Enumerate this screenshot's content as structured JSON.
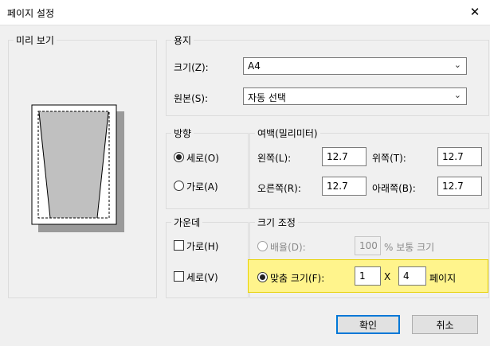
{
  "window": {
    "title": "페이지 설정",
    "close_glyph": "✕"
  },
  "preview": {
    "legend": "미리 보기"
  },
  "paper": {
    "legend": "용지",
    "size_label": "크기(Z):",
    "size_value": "A4",
    "source_label": "원본(S):",
    "source_value": "자동 선택"
  },
  "orientation": {
    "legend": "방향",
    "portrait_label": "세로(O)",
    "landscape_label": "가로(A)",
    "selected": "portrait"
  },
  "margins": {
    "legend": "여백(밀리미터)",
    "left_label": "왼쪽(L):",
    "left_value": "12.7",
    "top_label": "위쪽(T):",
    "top_value": "12.7",
    "right_label": "오른쪽(R):",
    "right_value": "12.7",
    "bottom_label": "아래쪽(B):",
    "bottom_value": "12.7"
  },
  "center": {
    "legend": "가운데",
    "horizontal_label": "가로(H)",
    "vertical_label": "세로(V)"
  },
  "scaling": {
    "legend": "크기 조정",
    "adjust_label": "배율(D):",
    "adjust_value": "100",
    "adjust_suffix": "% 보통 크기",
    "fit_label": "맞춤 크기(F):",
    "fit_wide_value": "1",
    "fit_x": "X",
    "fit_tall_value": "4",
    "fit_suffix": "페이지",
    "selected": "fit",
    "highlight_color": "#fff48c"
  },
  "buttons": {
    "ok": "확인",
    "cancel": "취소"
  },
  "colors": {
    "accent": "#0078d7"
  }
}
